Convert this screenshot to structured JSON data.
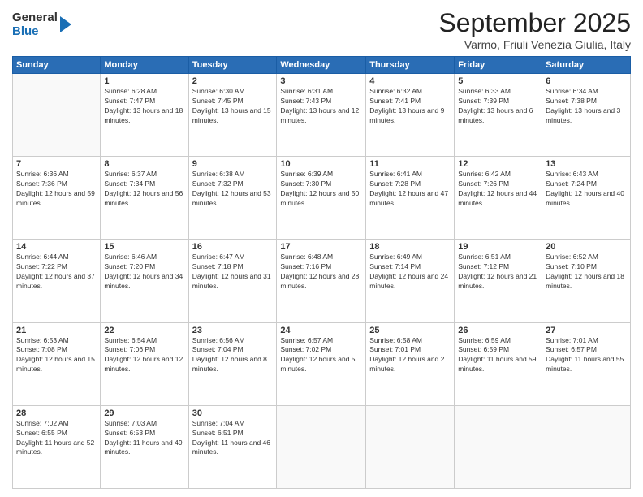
{
  "logo": {
    "general": "General",
    "blue": "Blue"
  },
  "title": "September 2025",
  "location": "Varmo, Friuli Venezia Giulia, Italy",
  "headers": [
    "Sunday",
    "Monday",
    "Tuesday",
    "Wednesday",
    "Thursday",
    "Friday",
    "Saturday"
  ],
  "weeks": [
    [
      {
        "day": "",
        "sunrise": "",
        "sunset": "",
        "daylight": ""
      },
      {
        "day": "1",
        "sunrise": "Sunrise: 6:28 AM",
        "sunset": "Sunset: 7:47 PM",
        "daylight": "Daylight: 13 hours and 18 minutes."
      },
      {
        "day": "2",
        "sunrise": "Sunrise: 6:30 AM",
        "sunset": "Sunset: 7:45 PM",
        "daylight": "Daylight: 13 hours and 15 minutes."
      },
      {
        "day": "3",
        "sunrise": "Sunrise: 6:31 AM",
        "sunset": "Sunset: 7:43 PM",
        "daylight": "Daylight: 13 hours and 12 minutes."
      },
      {
        "day": "4",
        "sunrise": "Sunrise: 6:32 AM",
        "sunset": "Sunset: 7:41 PM",
        "daylight": "Daylight: 13 hours and 9 minutes."
      },
      {
        "day": "5",
        "sunrise": "Sunrise: 6:33 AM",
        "sunset": "Sunset: 7:39 PM",
        "daylight": "Daylight: 13 hours and 6 minutes."
      },
      {
        "day": "6",
        "sunrise": "Sunrise: 6:34 AM",
        "sunset": "Sunset: 7:38 PM",
        "daylight": "Daylight: 13 hours and 3 minutes."
      }
    ],
    [
      {
        "day": "7",
        "sunrise": "Sunrise: 6:36 AM",
        "sunset": "Sunset: 7:36 PM",
        "daylight": "Daylight: 12 hours and 59 minutes."
      },
      {
        "day": "8",
        "sunrise": "Sunrise: 6:37 AM",
        "sunset": "Sunset: 7:34 PM",
        "daylight": "Daylight: 12 hours and 56 minutes."
      },
      {
        "day": "9",
        "sunrise": "Sunrise: 6:38 AM",
        "sunset": "Sunset: 7:32 PM",
        "daylight": "Daylight: 12 hours and 53 minutes."
      },
      {
        "day": "10",
        "sunrise": "Sunrise: 6:39 AM",
        "sunset": "Sunset: 7:30 PM",
        "daylight": "Daylight: 12 hours and 50 minutes."
      },
      {
        "day": "11",
        "sunrise": "Sunrise: 6:41 AM",
        "sunset": "Sunset: 7:28 PM",
        "daylight": "Daylight: 12 hours and 47 minutes."
      },
      {
        "day": "12",
        "sunrise": "Sunrise: 6:42 AM",
        "sunset": "Sunset: 7:26 PM",
        "daylight": "Daylight: 12 hours and 44 minutes."
      },
      {
        "day": "13",
        "sunrise": "Sunrise: 6:43 AM",
        "sunset": "Sunset: 7:24 PM",
        "daylight": "Daylight: 12 hours and 40 minutes."
      }
    ],
    [
      {
        "day": "14",
        "sunrise": "Sunrise: 6:44 AM",
        "sunset": "Sunset: 7:22 PM",
        "daylight": "Daylight: 12 hours and 37 minutes."
      },
      {
        "day": "15",
        "sunrise": "Sunrise: 6:46 AM",
        "sunset": "Sunset: 7:20 PM",
        "daylight": "Daylight: 12 hours and 34 minutes."
      },
      {
        "day": "16",
        "sunrise": "Sunrise: 6:47 AM",
        "sunset": "Sunset: 7:18 PM",
        "daylight": "Daylight: 12 hours and 31 minutes."
      },
      {
        "day": "17",
        "sunrise": "Sunrise: 6:48 AM",
        "sunset": "Sunset: 7:16 PM",
        "daylight": "Daylight: 12 hours and 28 minutes."
      },
      {
        "day": "18",
        "sunrise": "Sunrise: 6:49 AM",
        "sunset": "Sunset: 7:14 PM",
        "daylight": "Daylight: 12 hours and 24 minutes."
      },
      {
        "day": "19",
        "sunrise": "Sunrise: 6:51 AM",
        "sunset": "Sunset: 7:12 PM",
        "daylight": "Daylight: 12 hours and 21 minutes."
      },
      {
        "day": "20",
        "sunrise": "Sunrise: 6:52 AM",
        "sunset": "Sunset: 7:10 PM",
        "daylight": "Daylight: 12 hours and 18 minutes."
      }
    ],
    [
      {
        "day": "21",
        "sunrise": "Sunrise: 6:53 AM",
        "sunset": "Sunset: 7:08 PM",
        "daylight": "Daylight: 12 hours and 15 minutes."
      },
      {
        "day": "22",
        "sunrise": "Sunrise: 6:54 AM",
        "sunset": "Sunset: 7:06 PM",
        "daylight": "Daylight: 12 hours and 12 minutes."
      },
      {
        "day": "23",
        "sunrise": "Sunrise: 6:56 AM",
        "sunset": "Sunset: 7:04 PM",
        "daylight": "Daylight: 12 hours and 8 minutes."
      },
      {
        "day": "24",
        "sunrise": "Sunrise: 6:57 AM",
        "sunset": "Sunset: 7:02 PM",
        "daylight": "Daylight: 12 hours and 5 minutes."
      },
      {
        "day": "25",
        "sunrise": "Sunrise: 6:58 AM",
        "sunset": "Sunset: 7:01 PM",
        "daylight": "Daylight: 12 hours and 2 minutes."
      },
      {
        "day": "26",
        "sunrise": "Sunrise: 6:59 AM",
        "sunset": "Sunset: 6:59 PM",
        "daylight": "Daylight: 11 hours and 59 minutes."
      },
      {
        "day": "27",
        "sunrise": "Sunrise: 7:01 AM",
        "sunset": "Sunset: 6:57 PM",
        "daylight": "Daylight: 11 hours and 55 minutes."
      }
    ],
    [
      {
        "day": "28",
        "sunrise": "Sunrise: 7:02 AM",
        "sunset": "Sunset: 6:55 PM",
        "daylight": "Daylight: 11 hours and 52 minutes."
      },
      {
        "day": "29",
        "sunrise": "Sunrise: 7:03 AM",
        "sunset": "Sunset: 6:53 PM",
        "daylight": "Daylight: 11 hours and 49 minutes."
      },
      {
        "day": "30",
        "sunrise": "Sunrise: 7:04 AM",
        "sunset": "Sunset: 6:51 PM",
        "daylight": "Daylight: 11 hours and 46 minutes."
      },
      {
        "day": "",
        "sunrise": "",
        "sunset": "",
        "daylight": ""
      },
      {
        "day": "",
        "sunrise": "",
        "sunset": "",
        "daylight": ""
      },
      {
        "day": "",
        "sunrise": "",
        "sunset": "",
        "daylight": ""
      },
      {
        "day": "",
        "sunrise": "",
        "sunset": "",
        "daylight": ""
      }
    ]
  ]
}
